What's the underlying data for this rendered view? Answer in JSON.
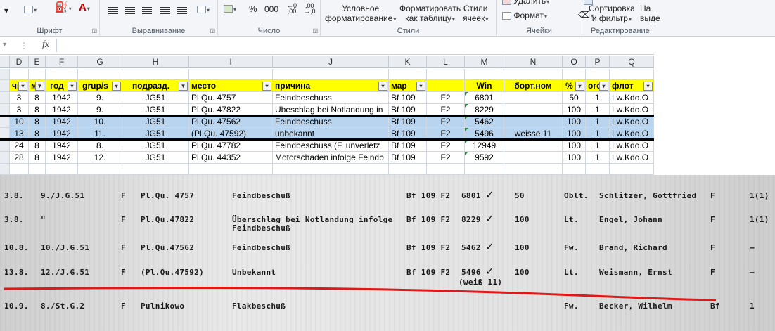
{
  "ribbon": {
    "groups": {
      "font": "Шрифт",
      "alignment": "Выравнивание",
      "number": "Число",
      "styles": "Стили",
      "cells": "Ячейки",
      "editing": "Редактирование"
    },
    "number_percent": "%",
    "number_thousands": "000",
    "cond_format_l1": "Условное",
    "cond_format_l2": "форматирование",
    "format_table_l1": "Форматировать",
    "format_table_l2": "как таблицу",
    "cell_styles_l1": "Стили",
    "cell_styles_l2": "ячеек",
    "delete": "Удалить",
    "format": "Формат",
    "sort_l1": "Сортировка",
    "sort_l2": "и фильтр",
    "find_l1": "На",
    "find_l2": "выде"
  },
  "formula_bar": {
    "fx": "fx",
    "value": ""
  },
  "columns": [
    {
      "letter": "D"
    },
    {
      "letter": "E"
    },
    {
      "letter": "F"
    },
    {
      "letter": "G"
    },
    {
      "letter": "H"
    },
    {
      "letter": "I"
    },
    {
      "letter": "J"
    },
    {
      "letter": "K"
    },
    {
      "letter": "L"
    },
    {
      "letter": "M"
    },
    {
      "letter": "N"
    },
    {
      "letter": "O"
    },
    {
      "letter": "P"
    },
    {
      "letter": "Q"
    }
  ],
  "header_row": [
    "чи",
    "м",
    "год",
    "grup/s",
    "подразд.",
    "место",
    "причина",
    "мар",
    "",
    "Win",
    "борт.ном",
    "%",
    "ого",
    "флот"
  ],
  "rows": [
    {
      "cells": [
        "3",
        "8",
        "1942",
        "9.",
        "JG51",
        "Pl.Qu. 4757",
        "Feindbeschuss",
        "Bf 109",
        "F2",
        "6801",
        "",
        "50",
        "1",
        "Lw.Kdo.O"
      ],
      "selected": false
    },
    {
      "cells": [
        "3",
        "8",
        "1942",
        "9.",
        "JG51",
        "Pl.Qu. 47822",
        "Ubeschlag bei Notlandung in",
        "Bf 109",
        "F2",
        "8229",
        "",
        "100",
        "1",
        "Lw.Kdo.O"
      ],
      "selected": false
    },
    {
      "cells": [
        "10",
        "8",
        "1942",
        "10.",
        "JG51",
        "Pl.Qu. 47562",
        "Feindbeschuss",
        "Bf 109",
        "F2",
        "5462",
        "",
        "100",
        "1",
        "Lw.Kdo.O"
      ],
      "selected": true
    },
    {
      "cells": [
        "13",
        "8",
        "1942",
        "11.",
        "JG51",
        "(Pl.Qu. 47592)",
        "unbekannt",
        "Bf 109",
        "F2",
        "5496",
        "weisse 11",
        "100",
        "1",
        "Lw.Kdo.O"
      ],
      "selected": true
    },
    {
      "cells": [
        "24",
        "8",
        "1942",
        "8.",
        "JG51",
        "Pl.Qu. 47782",
        "Feindbeschuss (F. unverletz",
        "Bf 109",
        "F2",
        "12949",
        "",
        "100",
        "1",
        "Lw.Kdo.O"
      ],
      "selected": false
    },
    {
      "cells": [
        "28",
        "8",
        "1942",
        "12.",
        "JG51",
        "Pl.Qu. 44352",
        "Motorschaden infolge Feindb",
        "Bf 109",
        "F2",
        "9592",
        "",
        "100",
        "1",
        "Lw.Kdo.O"
      ],
      "selected": false
    }
  ],
  "scan": {
    "rows": [
      {
        "date": "3.8.",
        "unit": "9./J.G.51",
        "flag": "F",
        "place": "Pl.Qu. 4757",
        "cause": "Feindbeschuß",
        "type": "Bf 109 F2",
        "wnr": "6801",
        "pct": "50",
        "rank": "Oblt.",
        "name": "Schlitzer, Gottfried",
        "f2": "F",
        "n": "1(1)"
      },
      {
        "date": "3.8.",
        "unit": "\"",
        "flag": "F",
        "place": "Pl.Qu.47822",
        "cause": "Überschlag bei Notlandung infolge",
        "cause2": "Feindbeschuß",
        "type": "Bf 109 F2",
        "wnr": "8229",
        "pct": "100",
        "rank": "Lt.",
        "name": "Engel,    Johann",
        "f2": "F",
        "n": "1(1)"
      },
      {
        "date": "10.8.",
        "unit": "10./J.G.51",
        "flag": "F",
        "place": "Pl.Qu.47562",
        "cause": "Feindbeschuß",
        "type": "Bf 109 F2",
        "wnr": "5462",
        "pct": "100",
        "rank": "Fw.",
        "name": "Brand,   Richard",
        "f2": "F",
        "n": "–"
      },
      {
        "date": "13.8.",
        "unit": "12./J.G.51",
        "flag": "F",
        "place": "(Pl.Qu.47592)",
        "cause": "Unbekannt",
        "type": "Bf 109 F2",
        "wnr": "5496",
        "extra": "(weiß 11)",
        "pct": "100",
        "rank": "Lt.",
        "name": "Weismann, Ernst",
        "f2": "F",
        "n": "–"
      },
      {
        "date": "10.9.",
        "unit": "8./St.G.2",
        "flag": "F",
        "place": "Pulnikowo",
        "cause": "Flakbeschuß",
        "type": "",
        "wnr": "",
        "pct": "",
        "rank": "Fw.",
        "name": "Becker,   Wilhelm",
        "f2": "Bf",
        "n": "1"
      }
    ]
  }
}
